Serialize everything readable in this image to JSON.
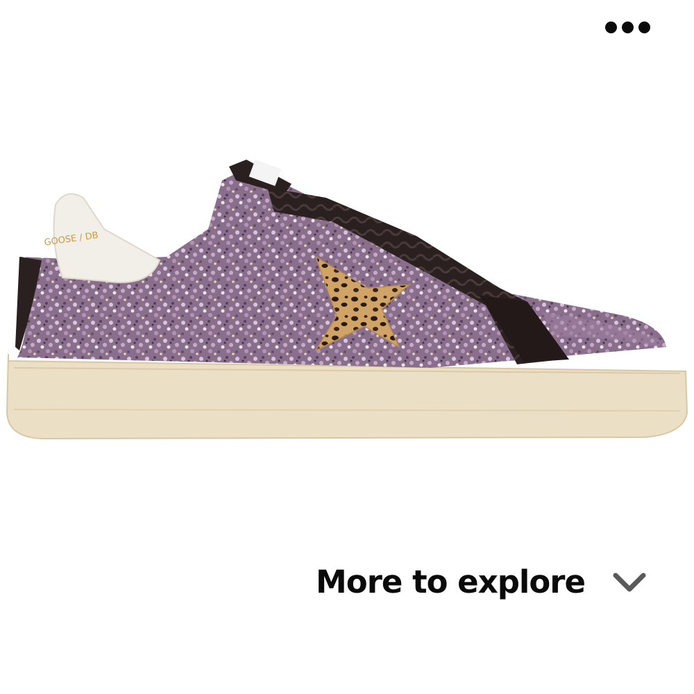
{
  "header": {
    "more_menu_icon": "more-horizontal-icon"
  },
  "product": {
    "image_icon": "sneaker-image",
    "heel_tab_text": "GOOSE / DB",
    "colors": {
      "glitter_base": "#8d7390",
      "glitter_light": "#d6c3d8",
      "leopard": "#c89a5a",
      "suede_lace": "#2a1e1e",
      "sole": "#ece1c8",
      "heel_tab": "#f1eee6"
    }
  },
  "explore": {
    "label": "More to explore",
    "chevron_icon": "chevron-down-icon"
  },
  "colors": {
    "text": "#0a0a0a",
    "chevron": "#5a5a5a",
    "background": "#ffffff"
  }
}
